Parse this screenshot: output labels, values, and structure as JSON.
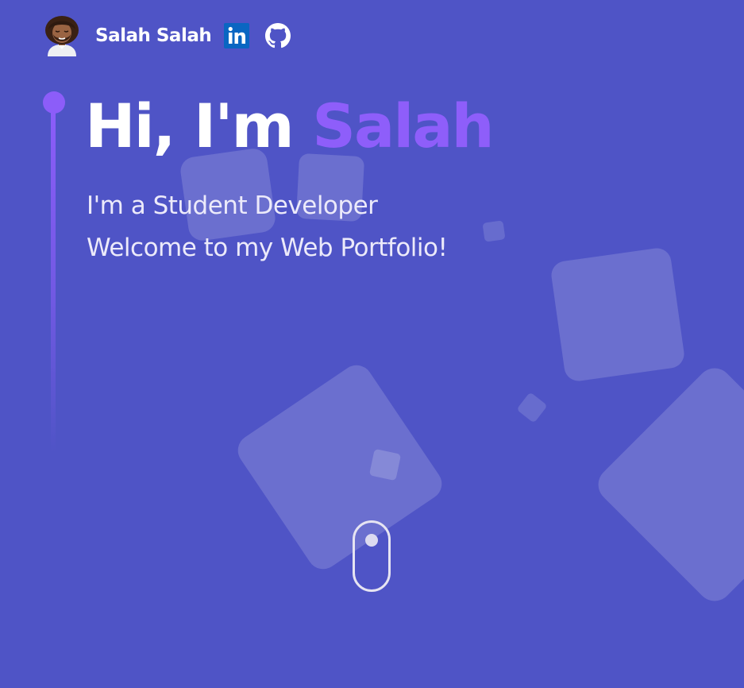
{
  "nav": {
    "name": "Salah Salah",
    "linkedin_icon": "linkedin-icon",
    "github_icon": "github-icon"
  },
  "hero": {
    "greeting": "Hi, I'm",
    "highlight_name": "Salah",
    "line1": "I'm a Student Developer",
    "line2": "Welcome to my Web Portfolio!"
  },
  "colors": {
    "background": "#4f54c6",
    "accent": "#8c5df9",
    "text": "#ffffff",
    "linkedin": "#0a66c2"
  },
  "icons": [
    "avatar-icon",
    "linkedin-icon",
    "github-icon",
    "scroll-mouse-icon"
  ]
}
